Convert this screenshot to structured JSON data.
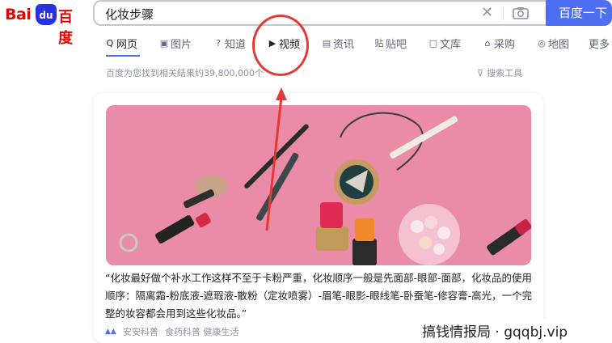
{
  "header": {
    "logo_left": "Bai",
    "logo_paw": "du",
    "logo_right": "百度",
    "search_value": "化妆步骤",
    "search_button": "百度一下"
  },
  "tabs": [
    {
      "icon": "Q",
      "label": "网页"
    },
    {
      "icon": "▣",
      "label": "图片"
    },
    {
      "icon": "?",
      "label": "知道"
    },
    {
      "icon": "▶",
      "label": "视频"
    },
    {
      "icon": "▤",
      "label": "资讯"
    },
    {
      "icon": "贴",
      "label": "贴吧"
    },
    {
      "icon": "□",
      "label": "文库"
    },
    {
      "icon": "⌂",
      "label": "采购"
    },
    {
      "icon": "◎",
      "label": "地图"
    },
    {
      "icon": "",
      "label": "更多"
    }
  ],
  "result_stats": "百度为您找到相关结果约39,800,000个",
  "search_tools": "搜索工具",
  "card": {
    "snippet": "“化妆最好做个补水工作这样不至于卡粉严重，化妆顺序一般是先面部-眼部-面部，化妆品的使用顺序：隔离霜-粉底液-遮瑕液-散粉（定妆喷雾）-眉笔-眼影-眼线笔-卧蚕笔-修容膏-高光，一个完整的妆容都会用到这些化妆品。”",
    "source_1": "安安科普",
    "source_2": "食药科普 健康生活"
  },
  "watermark": "搞钱情报局 · gqqbj.vip",
  "colors": {
    "brand_blue": "#4e6ef2",
    "logo_red": "#e10602",
    "annotation_red": "#e53935",
    "image_pink": "#e98aa6"
  }
}
